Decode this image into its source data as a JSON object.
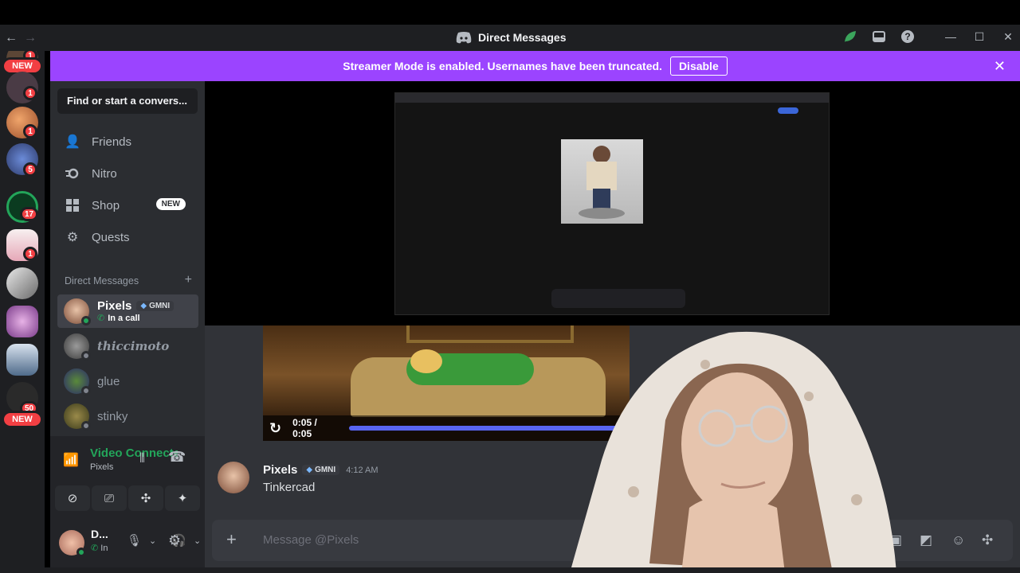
{
  "titlebar": {
    "back_icon": "arrow-left-icon",
    "forward_icon": "arrow-right-icon",
    "title": "Direct Messages",
    "icons": [
      "discord-logo-icon",
      "leaf-icon",
      "inbox-icon",
      "help-icon",
      "minimize-icon",
      "maximize-icon",
      "close-icon"
    ]
  },
  "banner": {
    "message": "Streamer Mode is enabled. Usernames have been truncated.",
    "button": "Disable",
    "color": "#9b44ff"
  },
  "rail": {
    "new_label_top": "NEW",
    "new_label_bottom": "NEW",
    "badges": [
      "1",
      "1",
      "1",
      "5",
      "17",
      "1",
      "50"
    ]
  },
  "sidebar": {
    "search_placeholder": "Find or start a convers...",
    "nav": [
      {
        "label": "Friends",
        "icon": "friends-icon"
      },
      {
        "label": "Nitro",
        "icon": "nitro-icon"
      },
      {
        "label": "Shop",
        "icon": "shop-icon",
        "badge": "NEW"
      },
      {
        "label": "Quests",
        "icon": "quests-icon"
      }
    ],
    "dm_header": "Direct Messages",
    "dm_add": "+",
    "dms": [
      {
        "name": "Pixels",
        "tag": "GMNI",
        "status": "In a call",
        "active": true
      },
      {
        "name": "thiccimoto"
      },
      {
        "name": "glue"
      },
      {
        "name": "stinky"
      }
    ]
  },
  "voice": {
    "title": "Video Connecte",
    "channel": "Pixels"
  },
  "user": {
    "name": "D...",
    "status": "In"
  },
  "video": {
    "time": "0:05 / 0:05",
    "progress": 1.0
  },
  "message": {
    "author": "Pixels",
    "tag": "GMNI",
    "time": "4:12 AM",
    "text": "Tinkercad"
  },
  "composer": {
    "placeholder": "Message @Pixels",
    "plus": "+"
  },
  "colors": {
    "accent": "#5865f2",
    "online": "#23a55a",
    "danger": "#f23f43"
  }
}
